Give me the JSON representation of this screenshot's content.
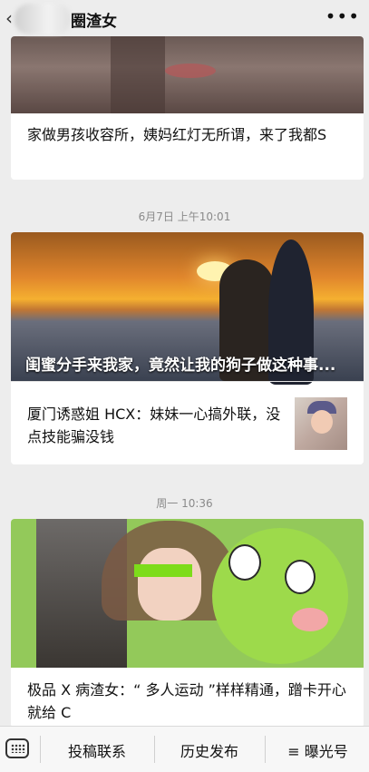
{
  "topbar": {
    "back_icon": "‹",
    "title": "圈渣女",
    "more_icon": "•••"
  },
  "articles": [
    {
      "title": "家做男孩收容所，姨妈红灯无所谓，来了我都S"
    },
    {
      "timestamp": "6月7日 上午10:01",
      "headline": "闺蜜分手来我家，竟然让我的狗子做这种事...",
      "sub_title": "厦门诱惑姐 HCX：妹妹一心搞外联，没点技能骗没钱"
    },
    {
      "timestamp": "周一 10:36",
      "title": "极品 X 病渣女：“ 多人运动 ”样样精通，蹭卡开心就给 C"
    }
  ],
  "bottom_menu": {
    "items": [
      "投稿联系",
      "历史发布",
      "≡ 曝光号"
    ]
  }
}
